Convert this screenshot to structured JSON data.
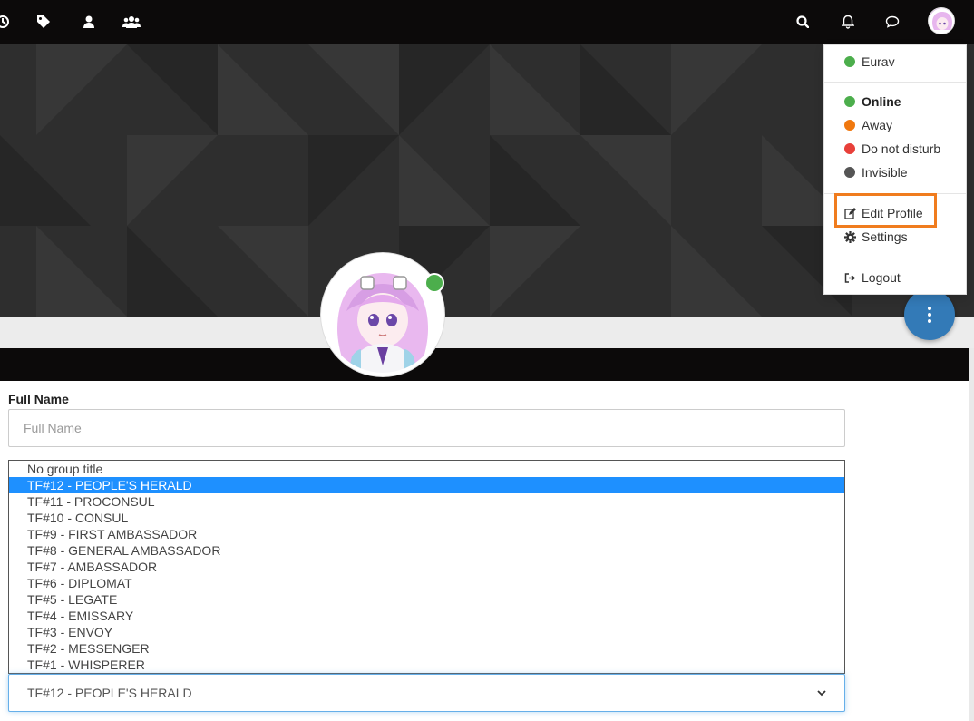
{
  "navbar": {
    "left_icons": [
      "history-icon",
      "tags-icon",
      "user-icon",
      "users-icon"
    ],
    "right_icons": [
      "search-icon",
      "bell-icon",
      "chat-icon"
    ]
  },
  "user_menu": {
    "username": "Eurav",
    "status_options": [
      {
        "label": "Online",
        "color": "#4cae4c",
        "bold": true
      },
      {
        "label": "Away",
        "color": "#f0780f",
        "bold": false
      },
      {
        "label": "Do not disturb",
        "color": "#e8403a",
        "bold": false
      },
      {
        "label": "Invisible",
        "color": "#555555",
        "bold": false
      }
    ],
    "edit_profile": "Edit Profile",
    "settings": "Settings",
    "logout": "Logout"
  },
  "form": {
    "full_name_label": "Full Name",
    "full_name_placeholder": "Full Name",
    "group_title_selected": "TF#12 - PEOPLE'S HERALD",
    "group_title_options": [
      "No group title",
      "TF#12 - PEOPLE'S HERALD",
      "TF#11 - PROCONSUL",
      "TF#10 - CONSUL",
      "TF#9 - FIRST AMBASSADOR",
      "TF#8 - GENERAL AMBASSADOR",
      "TF#7 - AMBASSADOR",
      "TF#6 - DIPLOMAT",
      "TF#5 - LEGATE",
      "TF#4 - EMISSARY",
      "TF#3 - ENVOY",
      "TF#2 - MESSENGER",
      "TF#1 - WHISPERER"
    ]
  },
  "colors": {
    "navbar": "#0c0a0a",
    "accent": "#337ab7",
    "highlight": "#f07c1e",
    "online": "#4cae4c",
    "selected_option": "#1e90ff"
  }
}
